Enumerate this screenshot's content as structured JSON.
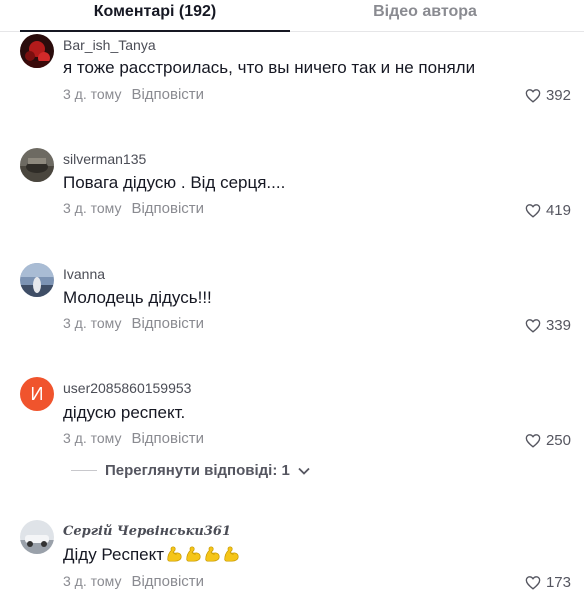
{
  "tabs": {
    "comments": "Коментарі (192)",
    "author_videos": "Відео автора"
  },
  "comments": [
    {
      "username": "Bar_ish_Tanya",
      "text": "я тоже расстроилась, что вы ничего так и не поняли",
      "time": "3 д. тому",
      "reply": "Відповісти",
      "likes": "392"
    },
    {
      "username": "silverman135",
      "text": "Повага дідусю . Від серця....",
      "time": "3 д. тому",
      "reply": "Відповісти",
      "likes": "419"
    },
    {
      "username": "Ivanna",
      "text": "Молодець дідусь!!!",
      "time": "3 д. тому",
      "reply": "Відповісти",
      "likes": "339"
    },
    {
      "username": "user2085860159953",
      "avatar_letter": "И",
      "text": "дідусю респект.",
      "time": "3 д. тому",
      "reply": "Відповісти",
      "likes": "250"
    },
    {
      "username": "Сергій Червінськи361",
      "text": "Діду Респект",
      "emoji": [
        "flexed-biceps",
        "flexed-biceps",
        "flexed-biceps",
        "flexed-biceps"
      ],
      "time": "3 д. тому",
      "reply": "Відповісти",
      "likes": "173"
    }
  ],
  "view_replies": "Переглянути відповіді: 1",
  "colors": {
    "text_primary": "#161823",
    "text_secondary": "#8a8b91",
    "letter_avatar": "#f0542d",
    "emoji": "#f5c518"
  }
}
